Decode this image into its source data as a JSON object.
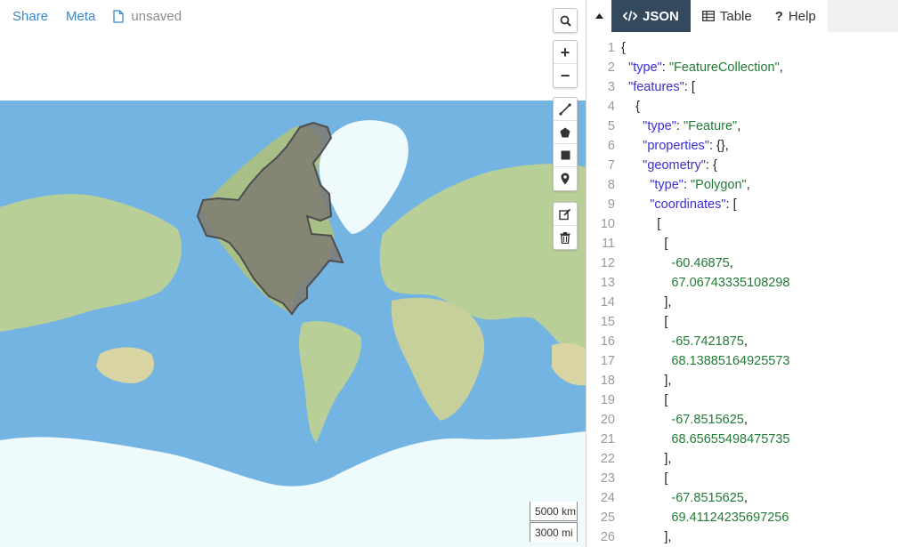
{
  "nav": {
    "share_label": "Share",
    "meta_label": "Meta",
    "file_status": "unsaved",
    "file_icon": "file-icon"
  },
  "map": {
    "controls": {
      "search_icon": "search-icon",
      "zoom_in_label": "+",
      "zoom_out_label": "−",
      "draw_tools": [
        "draw-line-icon",
        "draw-polygon-icon",
        "draw-rectangle-icon",
        "draw-marker-icon"
      ],
      "edit_tools": [
        "edit-layers-icon",
        "delete-layers-icon"
      ]
    },
    "scale": {
      "metric": "5000 km",
      "imperial": "3000 mi"
    },
    "colors": {
      "ocean": "#74b4e3",
      "land": "#b9cf98",
      "ice": "#eefafb",
      "feature_fill": "#7f7a70",
      "feature_stroke": "#4d4d4d"
    }
  },
  "editor": {
    "collapse_icon": "caret-up-icon",
    "tabs": [
      {
        "label": "JSON",
        "icon": "code-icon",
        "active": true
      },
      {
        "label": "Table",
        "icon": "table-icon",
        "active": false
      },
      {
        "label": "Help",
        "icon": "question-icon",
        "active": false
      }
    ],
    "line_numbers": [
      "1",
      "2",
      "3",
      "4",
      "5",
      "6",
      "7",
      "8",
      "9",
      "10",
      "11",
      "12",
      "13",
      "14",
      "15",
      "16",
      "17",
      "18",
      "19",
      "20",
      "21",
      "22",
      "23",
      "24",
      "25",
      "26"
    ],
    "code": [
      {
        "indent": "",
        "key": "",
        "punct": "{"
      },
      {
        "indent": "  ",
        "key": "\"type\"",
        "sep": ": ",
        "value": "\"FeatureCollection\"",
        "vtype": "s",
        "punct": ","
      },
      {
        "indent": "  ",
        "key": "\"features\"",
        "sep": ": ",
        "punct": "["
      },
      {
        "indent": "    ",
        "key": "",
        "punct": "{"
      },
      {
        "indent": "      ",
        "key": "\"type\"",
        "sep": ": ",
        "value": "\"Feature\"",
        "vtype": "s",
        "punct": ","
      },
      {
        "indent": "      ",
        "key": "\"properties\"",
        "sep": ": ",
        "punct": "{},"
      },
      {
        "indent": "      ",
        "key": "\"geometry\"",
        "sep": ": ",
        "punct": "{"
      },
      {
        "indent": "        ",
        "key": "\"type\"",
        "sep": ": ",
        "value": "\"Polygon\"",
        "vtype": "s",
        "punct": ","
      },
      {
        "indent": "        ",
        "key": "\"coordinates\"",
        "sep": ": ",
        "punct": "["
      },
      {
        "indent": "          ",
        "key": "",
        "punct": "["
      },
      {
        "indent": "            ",
        "key": "",
        "punct": "["
      },
      {
        "indent": "              ",
        "key": "",
        "value": "-60.46875",
        "vtype": "n",
        "punct": ","
      },
      {
        "indent": "              ",
        "key": "",
        "value": "67.06743335108298",
        "vtype": "n",
        "punct": ""
      },
      {
        "indent": "            ",
        "key": "",
        "punct": "],"
      },
      {
        "indent": "            ",
        "key": "",
        "punct": "["
      },
      {
        "indent": "              ",
        "key": "",
        "value": "-65.7421875",
        "vtype": "n",
        "punct": ","
      },
      {
        "indent": "              ",
        "key": "",
        "value": "68.13885164925573",
        "vtype": "n",
        "punct": ""
      },
      {
        "indent": "            ",
        "key": "",
        "punct": "],"
      },
      {
        "indent": "            ",
        "key": "",
        "punct": "["
      },
      {
        "indent": "              ",
        "key": "",
        "value": "-67.8515625",
        "vtype": "n",
        "punct": ","
      },
      {
        "indent": "              ",
        "key": "",
        "value": "68.65655498475735",
        "vtype": "n",
        "punct": ""
      },
      {
        "indent": "            ",
        "key": "",
        "punct": "],"
      },
      {
        "indent": "            ",
        "key": "",
        "punct": "["
      },
      {
        "indent": "              ",
        "key": "",
        "value": "-67.8515625",
        "vtype": "n",
        "punct": ","
      },
      {
        "indent": "              ",
        "key": "",
        "value": "69.41124235697256",
        "vtype": "n",
        "punct": ""
      },
      {
        "indent": "            ",
        "key": "",
        "punct": "],"
      }
    ]
  }
}
